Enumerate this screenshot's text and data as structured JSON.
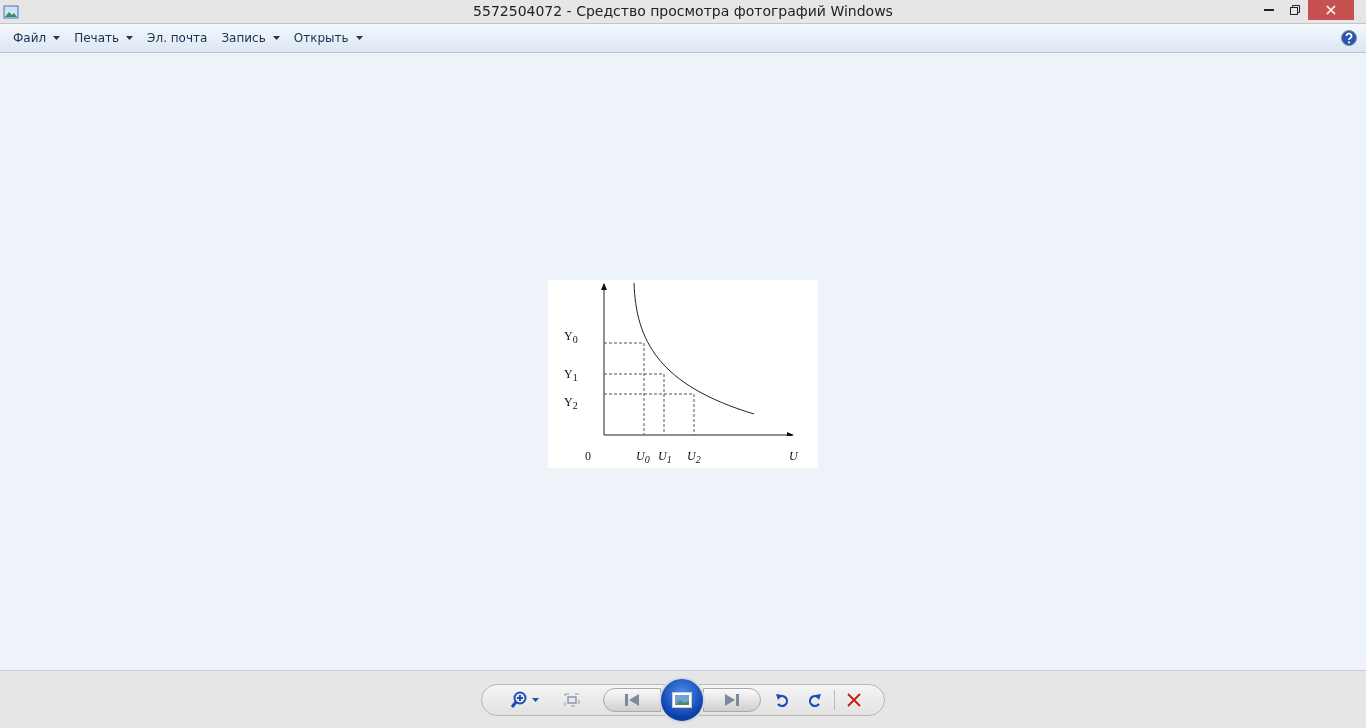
{
  "window": {
    "title": "5572504072 - Средство просмотра фотографий Windows"
  },
  "menu": [
    {
      "label": "Файл",
      "dropdown": true
    },
    {
      "label": "Печать",
      "dropdown": true
    },
    {
      "label": "Эл. почта",
      "dropdown": false
    },
    {
      "label": "Запись",
      "dropdown": true
    },
    {
      "label": "Открыть",
      "dropdown": true
    }
  ],
  "figure": {
    "y_labels": [
      "Y$_{0}$",
      "Y$_{1}$",
      "Y$_{2}$"
    ],
    "origin": "0",
    "x_labels": [
      "U$_{0}$",
      "U$_{1}$",
      "U$_{2}$"
    ],
    "x_axis_label": "U"
  }
}
